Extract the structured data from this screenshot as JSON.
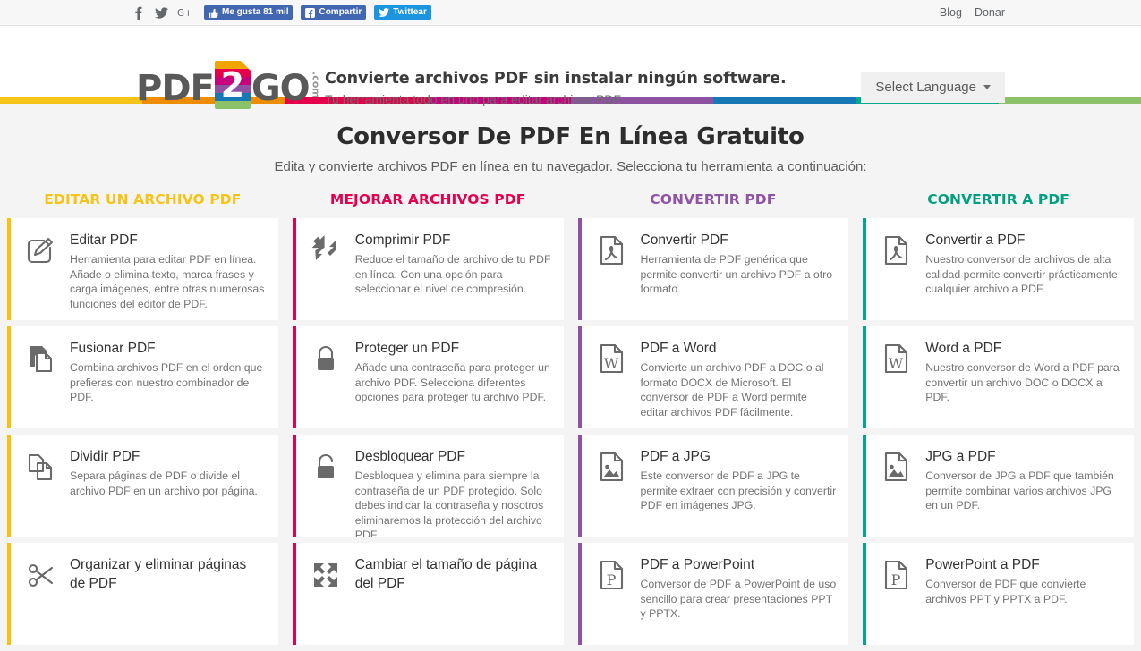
{
  "topbar": {
    "social_icons": [
      "facebook-icon",
      "twitter-icon",
      "googleplus-icon"
    ],
    "like_label": "Me gusta 81 mil",
    "share_label": "Compartir",
    "tweet_label": "Twittear",
    "links": [
      "Blog",
      "Donar"
    ]
  },
  "header": {
    "logo_left": "PDF",
    "logo_block": "2",
    "logo_right": "GO",
    "logo_com": ".com",
    "tagline_title": "Convierte archivos PDF sin instalar ningún software.",
    "tagline_sub": "Tu herramienta todo en uno para editar archivos PDF.",
    "language_label": "Select Language"
  },
  "rainbow": [
    "#f5c417",
    "#ef8d00",
    "#e5004c",
    "#c8007c",
    "#8d52a1",
    "#1678b5",
    "#00a88e",
    "#8cc267"
  ],
  "main": {
    "title": "Conversor De PDF En Línea Gratuito",
    "subtitle": "Edita y convierte archivos PDF en línea en tu navegador. Selecciona tu herramienta a continuación:"
  },
  "columns": [
    {
      "heading": "EDITAR UN ARCHIVO PDF",
      "color": "#f5c417",
      "accent": "#f9c00c",
      "cards": [
        {
          "icon": "edit-document-icon",
          "title": "Editar PDF",
          "desc": "Herramienta para editar PDF en línea. Añade o elimina texto, marca frases y carga imágenes, entre otras numerosas funciones del editor de PDF."
        },
        {
          "icon": "merge-documents-icon",
          "title": "Fusionar PDF",
          "desc": "Combina archivos PDF en el orden que prefieras con nuestro combinador de PDF."
        },
        {
          "icon": "split-documents-icon",
          "title": "Dividir PDF",
          "desc": "Separa páginas de PDF o divide el archivo PDF en un archivo por página."
        },
        {
          "icon": "scissors-icon",
          "title": "Organizar y eliminar páginas de PDF",
          "desc": ""
        }
      ]
    },
    {
      "heading": "MEJORAR ARCHIVOS PDF",
      "color": "#e5004c",
      "accent": "#e5004c",
      "cards": [
        {
          "icon": "compress-arrows-icon",
          "title": "Comprimir PDF",
          "desc": "Reduce el tamaño de archivo de tu PDF en línea. Con una opción para seleccionar el nivel de compresión."
        },
        {
          "icon": "lock-closed-icon",
          "title": "Proteger un PDF",
          "desc": "Añade una contraseña para proteger un archivo PDF. Selecciona diferentes opciones para proteger tu archivo PDF."
        },
        {
          "icon": "lock-open-icon",
          "title": "Desbloquear PDF",
          "desc": "Desbloquea y elimina para siempre la contraseña de un PDF protegido. Solo debes indicar la contraseña y nosotros eliminaremos la protección del archivo PDF."
        },
        {
          "icon": "expand-arrows-icon",
          "title": "Cambiar el tamaño de página del PDF",
          "desc": ""
        }
      ]
    },
    {
      "heading": "CONVERTIR PDF",
      "color": "#9054a4",
      "accent": "#8d52a1",
      "cards": [
        {
          "icon": "pdf-file-icon",
          "title": "Convertir PDF",
          "desc": "Herramienta de PDF genérica que permite convertir un archivo PDF a otro formato."
        },
        {
          "icon": "word-file-icon",
          "title": "PDF a Word",
          "desc": "Convierte un archivo PDF a DOC o al formato DOCX de Microsoft. El conversor de PDF a Word permite editar archivos PDF fácilmente."
        },
        {
          "icon": "image-file-icon",
          "title": "PDF a JPG",
          "desc": "Este conversor de PDF a JPG te permite extraer con precisión y convertir PDF en imágenes JPG."
        },
        {
          "icon": "powerpoint-file-icon",
          "title": "PDF a PowerPoint",
          "desc": "Conversor de PDF a PowerPoint de uso sencillo para crear presentaciones PPT y PPTX."
        }
      ]
    },
    {
      "heading": "CONVERTIR A PDF",
      "color": "#00a07f",
      "accent": "#00a88e",
      "cards": [
        {
          "icon": "pdf-file-icon",
          "title": "Convertir a PDF",
          "desc": "Nuestro conversor de archivos de alta calidad permite convertir prácticamente cualquier archivo a PDF."
        },
        {
          "icon": "word-file-icon",
          "title": "Word a PDF",
          "desc": "Nuestro conversor de Word a PDF para convertir un archivo DOC o DOCX a PDF."
        },
        {
          "icon": "image-file-icon",
          "title": "JPG a PDF",
          "desc": "Conversor de JPG a PDF que también permite combinar varios archivos JPG en un PDF."
        },
        {
          "icon": "powerpoint-file-icon",
          "title": "PowerPoint a PDF",
          "desc": "Conversor de PDF que convierte archivos PPT y PPTX a PDF."
        }
      ]
    }
  ]
}
